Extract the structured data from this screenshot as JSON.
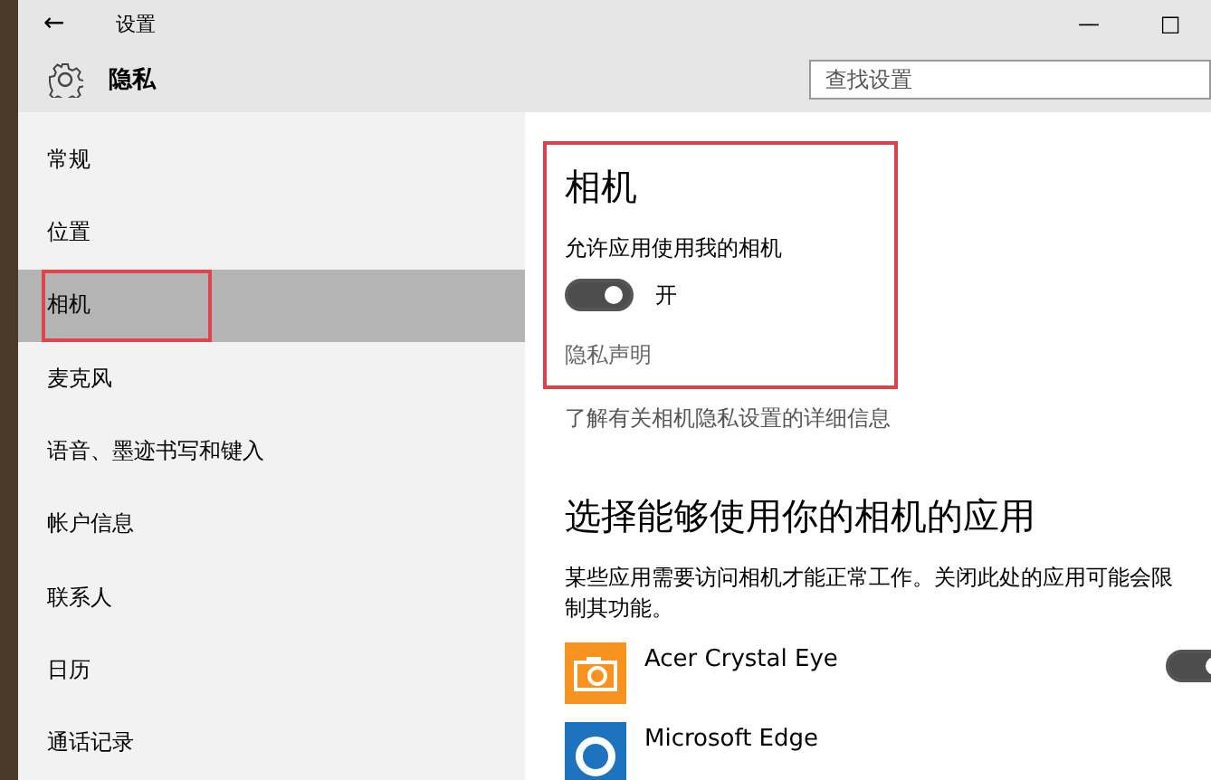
{
  "window": {
    "title": "设置",
    "back": "←",
    "minimize": "—",
    "maximize": "□"
  },
  "header": {
    "title": "隐私",
    "search": {
      "placeholder": "查找设置"
    }
  },
  "sidebar": {
    "items": [
      {
        "label": "常规",
        "selected": false
      },
      {
        "label": "位置",
        "selected": false
      },
      {
        "label": "相机",
        "selected": true
      },
      {
        "label": "麦克风",
        "selected": false
      },
      {
        "label": "语音、墨迹书写和键入",
        "selected": false
      },
      {
        "label": "帐户信息",
        "selected": false
      },
      {
        "label": "联系人",
        "selected": false
      },
      {
        "label": "日历",
        "selected": false
      },
      {
        "label": "通话记录",
        "selected": false
      }
    ]
  },
  "content": {
    "title": "相机",
    "toggle_label": "允许应用使用我的相机",
    "toggle": {
      "on": true,
      "label": "开"
    },
    "privacy_link": "隐私声明",
    "more_link": "了解有关相机隐私设置的详细信息",
    "apps_heading": "选择能够使用你的相机的应用",
    "apps_description": "某些应用需要访问相机才能正常工作。关闭此处的应用可能会限制其功能。",
    "apps": [
      {
        "name": "Acer Crystal Eye",
        "kind": "camera",
        "color": "#f7931e",
        "toggle_on": true
      },
      {
        "name": "Microsoft Edge",
        "kind": "edge",
        "color": "#1e73be"
      }
    ]
  }
}
